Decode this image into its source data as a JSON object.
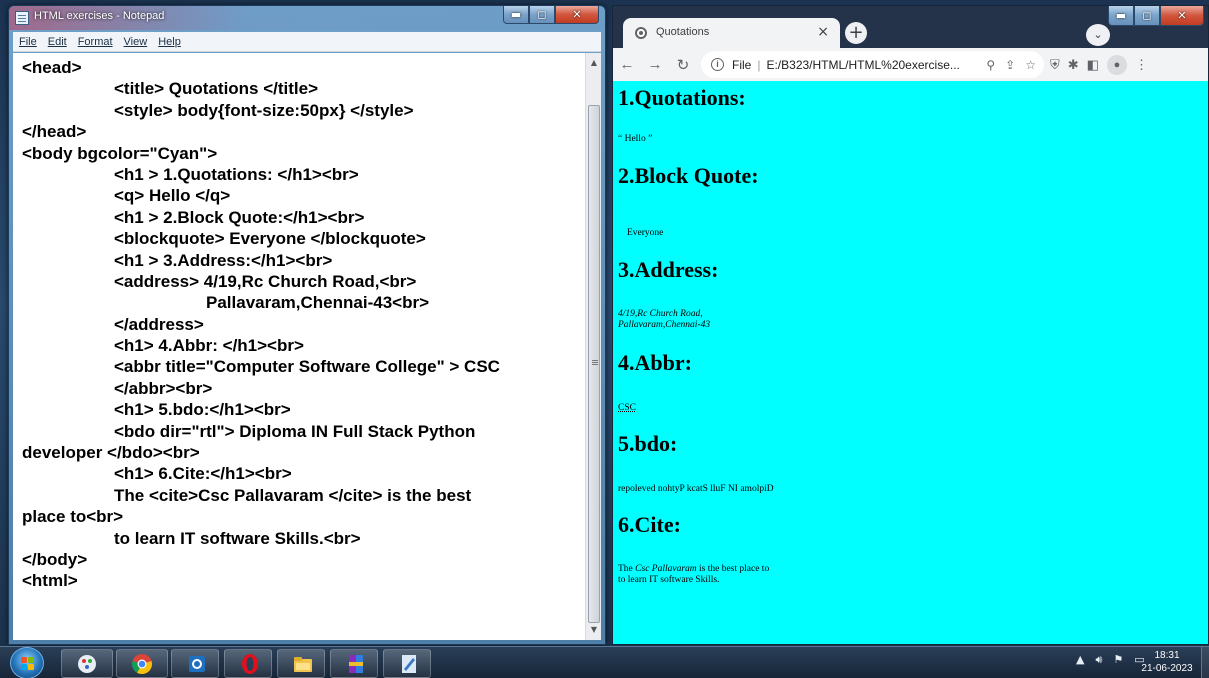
{
  "notepad": {
    "title": "HTML exercises - Notepad",
    "menu": [
      "File",
      "Edit",
      "Format",
      "View",
      "Help"
    ],
    "lines": [
      {
        "indent": 0,
        "text": "<head>"
      },
      {
        "indent": 1,
        "text": "<title> Quotations </title>"
      },
      {
        "indent": 1,
        "text": "<style> body{font-size:50px} </style>"
      },
      {
        "indent": 0,
        "text": "</head>"
      },
      {
        "indent": 0,
        "text": "<body bgcolor=\"Cyan\">"
      },
      {
        "indent": 1,
        "text": "<h1 > 1.Quotations: </h1><br>"
      },
      {
        "indent": 1,
        "text": "<q> Hello </q>"
      },
      {
        "indent": 1,
        "text": "<h1 > 2.Block Quote:</h1><br>"
      },
      {
        "indent": 1,
        "text": "<blockquote> Everyone </blockquote>"
      },
      {
        "indent": 1,
        "text": "<h1 > 3.Address:</h1><br>"
      },
      {
        "indent": 1,
        "text": "<address> 4/19,Rc Church Road,<br>"
      },
      {
        "indent": 2,
        "text": "Pallavaram,Chennai-43<br>"
      },
      {
        "indent": 1,
        "text": "</address>"
      },
      {
        "indent": 1,
        "text": "<h1> 4.Abbr: </h1><br>"
      },
      {
        "indent": 1,
        "text": "<abbr title=\"Computer Software College\" > CSC"
      },
      {
        "indent": 1,
        "text": "</abbr><br>"
      },
      {
        "indent": 1,
        "text": "<h1> 5.bdo:</h1><br>"
      },
      {
        "indent": 1,
        "text": "<bdo dir=\"rtl\"> Diploma IN Full Stack Python"
      },
      {
        "indent": 0,
        "text": "developer </bdo><br>"
      },
      {
        "indent": 1,
        "text": "<h1> 6.Cite:</h1><br>"
      },
      {
        "indent": 1,
        "text": "The <cite>Csc Pallavaram </cite> is the best"
      },
      {
        "indent": 0,
        "text": "place to<br>"
      },
      {
        "indent": 1,
        "text": "to learn IT software Skills.<br>"
      },
      {
        "indent": 0,
        "text": "</body>"
      },
      {
        "indent": 0,
        "text": "<html>"
      }
    ]
  },
  "browser": {
    "tab_title": "Quotations",
    "tab_close": "×",
    "new_tab": "+",
    "address_scheme": "File",
    "address_url": "E:/B323/HTML/HTML%20exercise...",
    "page": {
      "background": "#00ffff",
      "h1_quotations": "1.Quotations:",
      "quote_text": "“ Hello ”",
      "h1_blockquote": "2.Block Quote:",
      "blockquote_text": "Everyone",
      "h1_address": "3.Address:",
      "address_line1": "4/19,Rc Church Road,",
      "address_line2": "Pallavaram,Chennai-43",
      "h1_abbr": "4.Abbr:",
      "abbr_text": "CSC",
      "h1_bdo": "5.bdo:",
      "bdo_text": "repoleved nohtyP kcatS lluF NI amolpiD",
      "h1_cite": "6.Cite:",
      "cite_prefix": "The ",
      "cite_text": "Csc Pallavaram",
      "cite_suffix": " is the best place to",
      "cite_line2": "to learn IT software Skills."
    }
  },
  "taskbar": {
    "apps": [
      "paint-icon",
      "chrome-icon",
      "outlook-icon",
      "opera-icon",
      "file-explorer-icon",
      "winrar-icon",
      "notepad-icon"
    ],
    "clock_time": "18:31",
    "clock_date": "21-06-2023"
  },
  "colors": {
    "page_bg": "#00ffff",
    "window_frame": "#5a8ab6",
    "close_button": "#c8442b"
  }
}
